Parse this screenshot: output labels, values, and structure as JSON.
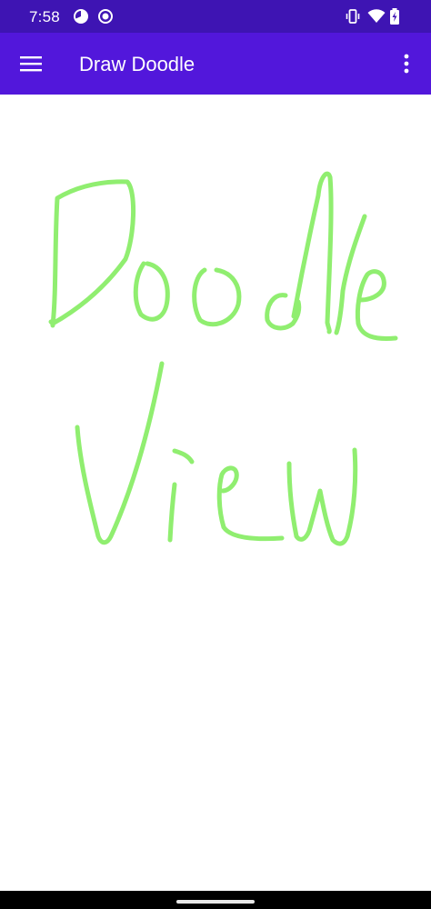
{
  "status_bar": {
    "time": "7:58",
    "icons": [
      "pie-chart-icon",
      "record-icon",
      "vibrate-icon",
      "wifi-icon",
      "battery-charging-icon"
    ]
  },
  "app_bar": {
    "title": "Draw Doodle",
    "menu_icon": "hamburger-menu-icon",
    "overflow_icon": "overflow-menu-icon",
    "background": "#5217db",
    "status_background": "#3e14b3"
  },
  "canvas": {
    "background": "#ffffff",
    "stroke_color": "#90ee70",
    "strokes_count": 11
  },
  "nav_bar": {
    "handle": "gesture-handle"
  }
}
